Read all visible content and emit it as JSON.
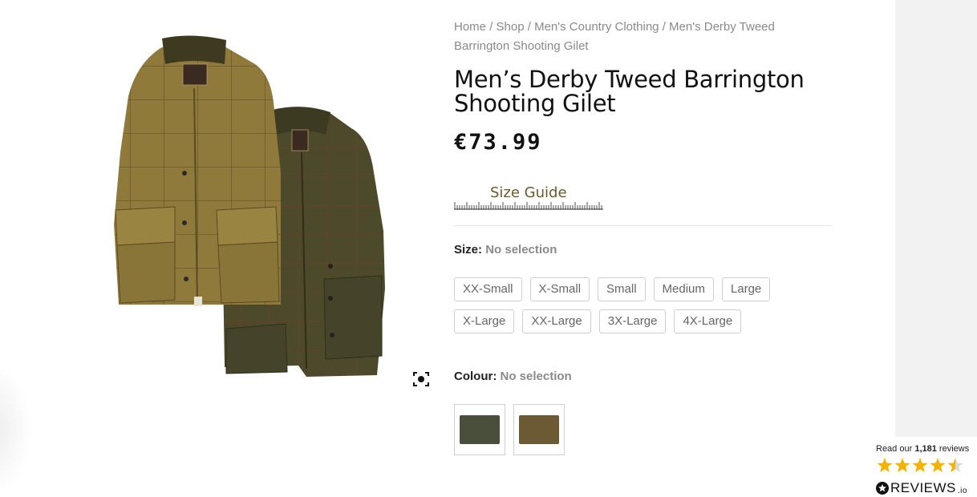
{
  "breadcrumb": {
    "items": [
      "Home",
      "Shop",
      "Men's Country Clothing",
      "Men's Derby Tweed Barrington Shooting Gilet"
    ],
    "separator": "/"
  },
  "product": {
    "title": "Men’s Derby Tweed Barrington Shooting Gilet",
    "price": "€73.99"
  },
  "size_guide": {
    "label": "Size Guide"
  },
  "size": {
    "label": "Size:",
    "selection": "No selection",
    "options_row1": [
      "XX-Small",
      "X-Small",
      "Small",
      "Medium",
      "Large"
    ],
    "options_row2": [
      "X-Large",
      "XX-Large",
      "3X-Large",
      "4X-Large"
    ]
  },
  "colour": {
    "label": "Colour:",
    "selection": "No selection",
    "swatch_colors": [
      "#4a4f3c",
      "#6b5a33"
    ]
  },
  "reviews": {
    "read_prefix": "Read our",
    "count": "1,181",
    "suffix": "reviews",
    "rating_stars": 4.5,
    "brand": "REVIEWS",
    "brand_suffix": ".io"
  },
  "icons": {
    "zoom": "zoom-focus-icon",
    "star": "star-icon"
  },
  "colors": {
    "star": "#f5b301",
    "size_guide_text": "#6b5a2a",
    "muted_text": "#8a8a8a"
  }
}
